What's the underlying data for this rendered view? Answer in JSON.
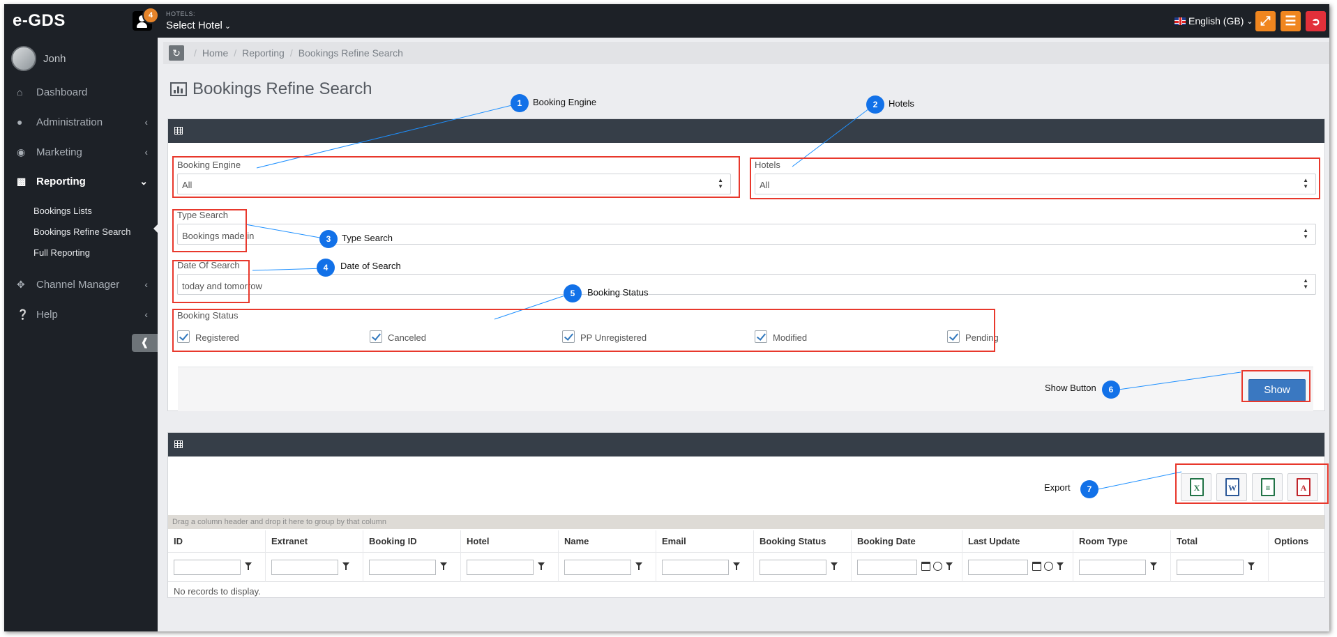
{
  "app": {
    "logo": "e-GDS",
    "notification_count": "4",
    "hotels_caption": "HOTELS:",
    "hotel_select": "Select Hotel"
  },
  "language": {
    "label": "English (GB)"
  },
  "sidebar": {
    "username": "Jonh",
    "items": [
      {
        "label": "Dashboard",
        "icon": "home-icon"
      },
      {
        "label": "Administration",
        "icon": "user-icon"
      },
      {
        "label": "Marketing",
        "icon": "target-icon"
      },
      {
        "label": "Reporting",
        "icon": "bar-chart-icon"
      },
      {
        "label": "Channel Manager",
        "icon": "move-arrows-icon"
      },
      {
        "label": "Help",
        "icon": "question-icon"
      }
    ],
    "reporting_sub": [
      "Bookings Lists",
      "Bookings Refine Search",
      "Full Reporting"
    ]
  },
  "breadcrumb": [
    "Home",
    "Reporting",
    "Bookings Refine Search"
  ],
  "page": {
    "title": "Bookings Refine Search"
  },
  "search_form": {
    "booking_engine": {
      "label": "Booking Engine",
      "value": "All"
    },
    "hotels": {
      "label": "Hotels",
      "value": "All"
    },
    "type_search": {
      "label": "Type Search",
      "value": "Bookings made in"
    },
    "date_of_search": {
      "label": "Date Of Search",
      "value": "today and tomorrow"
    },
    "booking_status": {
      "label": "Booking Status",
      "options": [
        {
          "label": "Registered",
          "checked": true
        },
        {
          "label": "Canceled",
          "checked": true
        },
        {
          "label": "PP Unregistered",
          "checked": true
        },
        {
          "label": "Modified",
          "checked": true
        },
        {
          "label": "Pending",
          "checked": true
        }
      ]
    },
    "show_button": "Show"
  },
  "annotations": [
    {
      "number": "1",
      "text": "Booking Engine"
    },
    {
      "number": "2",
      "text": "Hotels"
    },
    {
      "number": "3",
      "text": "Type Search"
    },
    {
      "number": "4",
      "text": "Date of Search"
    },
    {
      "number": "5",
      "text": "Booking Status"
    },
    {
      "number": "6",
      "text": "Show Button"
    },
    {
      "number": "7",
      "text": "Export"
    }
  ],
  "export": {
    "buttons": [
      {
        "glyph": "X",
        "icon": "excel-file-icon",
        "color": "#217346"
      },
      {
        "glyph": "W",
        "icon": "word-file-icon",
        "color": "#2b5797"
      },
      {
        "glyph": "≡",
        "icon": "text-file-icon",
        "color": "#217346"
      },
      {
        "glyph": "A",
        "icon": "pdf-file-icon",
        "color": "#c0262c"
      }
    ]
  },
  "grid": {
    "group_hint": "Drag a column header and drop it here to group by that column",
    "columns": [
      "ID",
      "Extranet",
      "Booking ID",
      "Hotel",
      "Name",
      "Email",
      "Booking Status",
      "Booking Date",
      "Last Update",
      "Room Type",
      "Total",
      "Options"
    ],
    "empty_text": "No records to display."
  },
  "colors": {
    "accent_blue": "#3a78c1",
    "annotation_red": "#e8382c",
    "marker_blue": "#1271e8",
    "topbar": "#1d2127",
    "orange": "#f0861f",
    "red": "#e2303a"
  }
}
